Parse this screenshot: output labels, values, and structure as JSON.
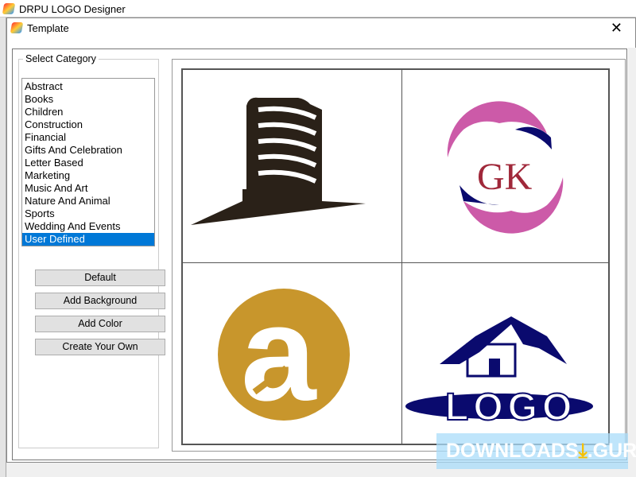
{
  "app": {
    "title": "DRPU LOGO Designer"
  },
  "dialog": {
    "title": "Template",
    "close_icon": "close-icon"
  },
  "category": {
    "label": "Select Category",
    "items": [
      "Abstract",
      "Books",
      "Children",
      "Construction",
      "Financial",
      "Gifts And Celebration",
      "Letter Based",
      "Marketing",
      "Music And Art",
      "Nature And Animal",
      "Sports",
      "Wedding And Events",
      "User Defined"
    ],
    "selected": "User Defined"
  },
  "buttons": {
    "default": "Default",
    "add_background": "Add Background",
    "add_color": "Add Color",
    "create_your_own": "Create Your Own"
  },
  "templates": {
    "gk_text": "GK",
    "logo_text": "LOGO",
    "a_text": "a"
  },
  "watermark": {
    "left": "DOWNLOADS",
    "right": ".GURU"
  },
  "colors": {
    "selection": "#0078d7",
    "building": "#2a2118",
    "pink": "#cc5aa8",
    "navy": "#0a0a6e",
    "gold": "#c8962c",
    "gk": "#a0283a"
  }
}
